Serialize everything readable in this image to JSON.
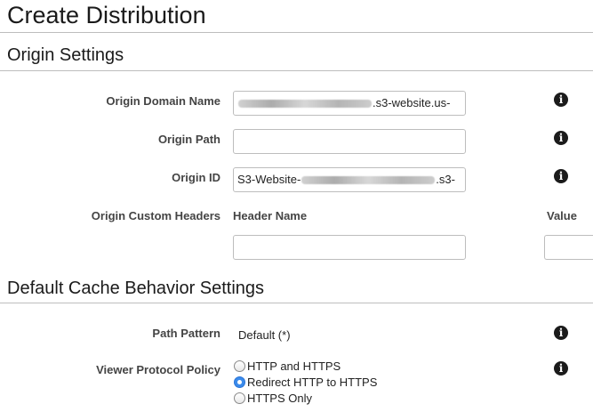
{
  "page": {
    "title": "Create Distribution"
  },
  "origin_settings": {
    "heading": "Origin Settings",
    "origin_domain_name": {
      "label": "Origin Domain Name",
      "value_prefix": "",
      "value_suffix": ".s3-website.us-"
    },
    "origin_path": {
      "label": "Origin Path",
      "value": ""
    },
    "origin_id": {
      "label": "Origin ID",
      "value_prefix": "S3-Website-",
      "value_suffix": ".s3-"
    },
    "custom_headers": {
      "label": "Origin Custom Headers",
      "header_name_col": "Header Name",
      "value_col": "Value",
      "header_name_value": "",
      "value_value": ""
    }
  },
  "cache_behavior": {
    "heading": "Default Cache Behavior Settings",
    "path_pattern": {
      "label": "Path Pattern",
      "value": "Default (*)"
    },
    "viewer_protocol_policy": {
      "label": "Viewer Protocol Policy",
      "options": [
        {
          "label": "HTTP and HTTPS",
          "selected": false
        },
        {
          "label": "Redirect HTTP to HTTPS",
          "selected": true
        },
        {
          "label": "HTTPS Only",
          "selected": false
        }
      ]
    }
  },
  "icons": {
    "info": "info-icon"
  },
  "colors": {
    "radio_selected": "#3b8beb",
    "rule": "#bdbdbd",
    "info_icon_bg": "#1b1b1b"
  }
}
